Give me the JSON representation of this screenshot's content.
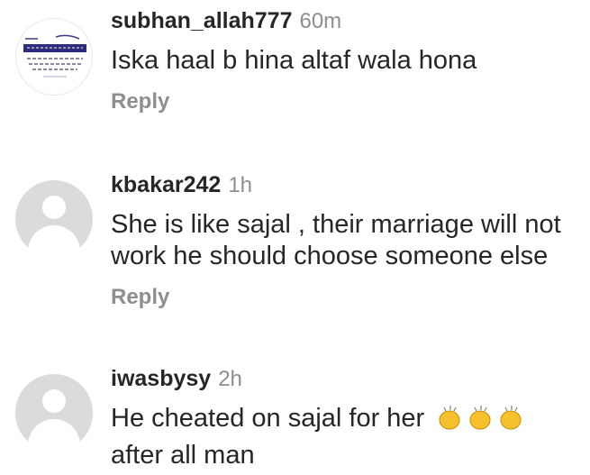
{
  "comments": [
    {
      "username": "subhan_allah777",
      "time": "60m",
      "text": "Iska haal b hina altaf wala hona",
      "reply_label": "Reply",
      "avatar": "urdu-text-image"
    },
    {
      "username": "kbakar242",
      "time": "1h",
      "text": "She is like sajal , their marriage will not work he should choose someone else",
      "reply_label": "Reply",
      "avatar": "default-avatar"
    },
    {
      "username": "iwasbysy",
      "time": "2h",
      "text": "He cheated on sajal for her",
      "text_emoji": "clapping-hands-emoji ×3",
      "text_after": "after all man",
      "avatar": "default-avatar"
    }
  ]
}
